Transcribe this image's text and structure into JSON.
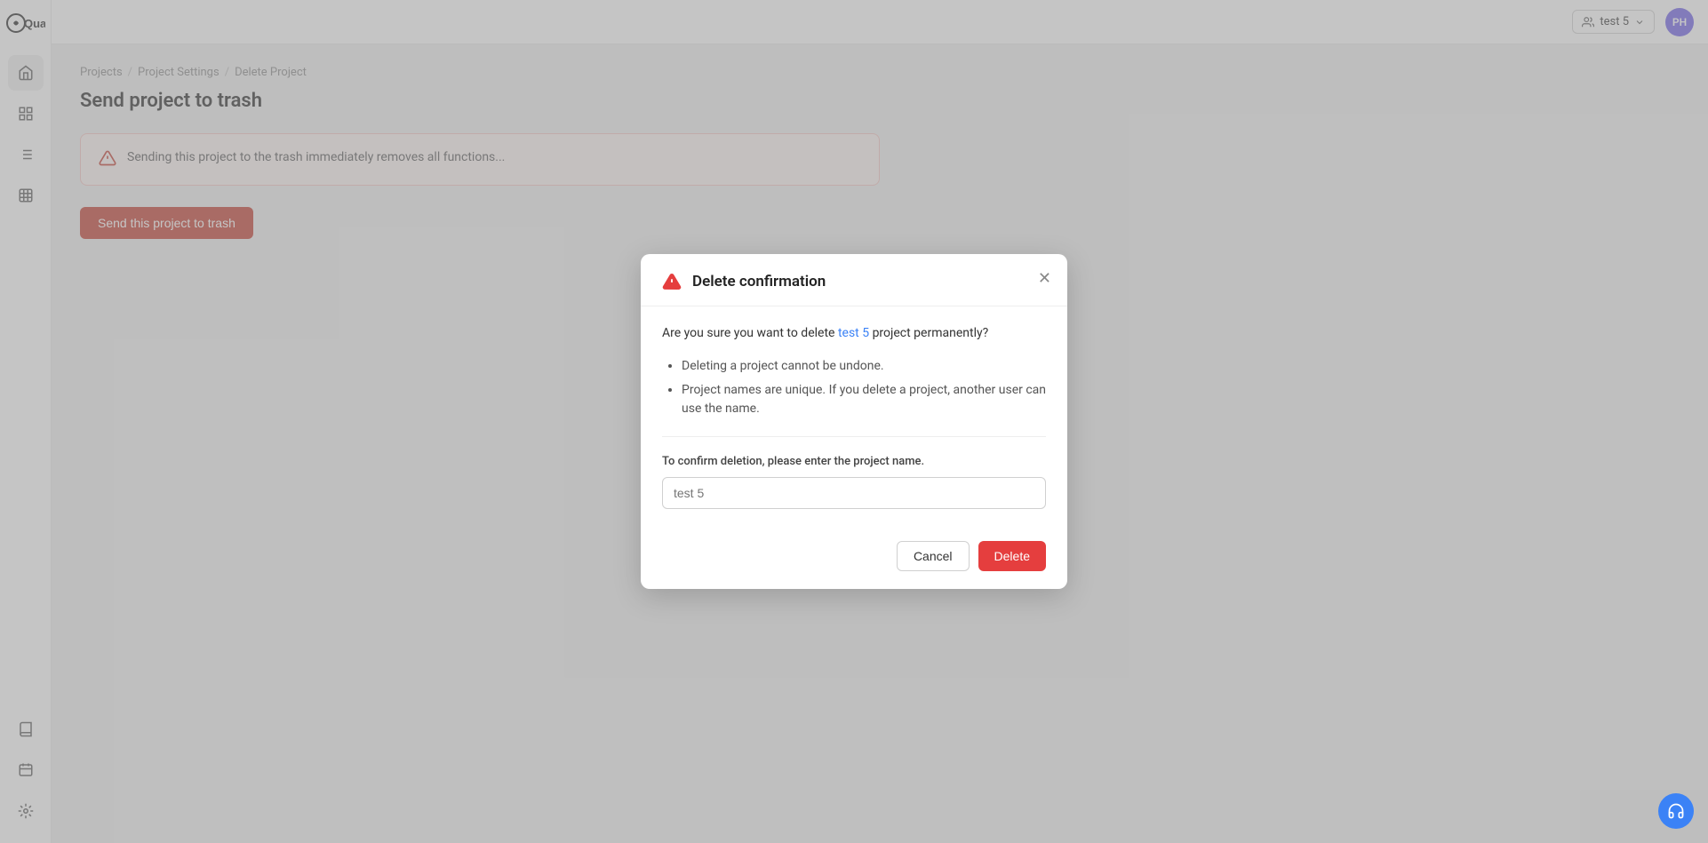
{
  "app": {
    "name": "Quapp"
  },
  "header": {
    "project_selector_label": "test 5",
    "avatar_initials": "PH"
  },
  "breadcrumb": {
    "items": [
      "Projects",
      "Project Settings",
      "Delete Project"
    ],
    "separator": "/"
  },
  "page": {
    "title": "Send project to trash",
    "warning_text": "Sending this project to the trash immediately removes all functions...",
    "send_trash_button": "Send this project to trash"
  },
  "modal": {
    "title": "Delete confirmation",
    "question_prefix": "Are you sure you want to delete ",
    "project_name": "test 5",
    "question_suffix": " project permanently?",
    "bullet_1": "Deleting a project cannot be undone.",
    "bullet_2": "Project names are unique. If you delete a project, another user can use the name.",
    "confirm_label": "To confirm deletion, please enter the project name.",
    "input_placeholder": "test 5",
    "cancel_label": "Cancel",
    "delete_label": "Delete"
  },
  "sidebar": {
    "nav_items": [
      {
        "name": "home",
        "icon": "⌂"
      },
      {
        "name": "projects",
        "icon": "□"
      },
      {
        "name": "tasks",
        "icon": "☰"
      },
      {
        "name": "reports",
        "icon": "▦"
      }
    ],
    "bottom_items": [
      {
        "name": "docs",
        "icon": "📖"
      },
      {
        "name": "activity",
        "icon": "🔍"
      },
      {
        "name": "integrations",
        "icon": "✦"
      }
    ]
  },
  "support": {
    "icon": "🎧"
  },
  "colors": {
    "accent_blue": "#3b82f6",
    "delete_red": "#e53e3e",
    "warning_red": "#c0392b"
  }
}
